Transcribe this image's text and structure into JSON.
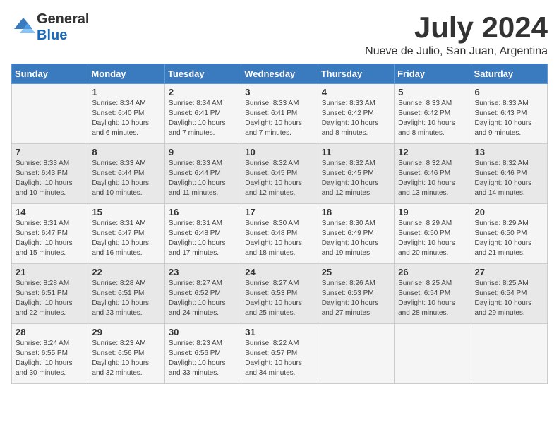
{
  "logo": {
    "general": "General",
    "blue": "Blue"
  },
  "title": "July 2024",
  "location": "Nueve de Julio, San Juan, Argentina",
  "days_of_week": [
    "Sunday",
    "Monday",
    "Tuesday",
    "Wednesday",
    "Thursday",
    "Friday",
    "Saturday"
  ],
  "weeks": [
    [
      {
        "day": "",
        "sunrise": "",
        "sunset": "",
        "daylight": ""
      },
      {
        "day": "1",
        "sunrise": "Sunrise: 8:34 AM",
        "sunset": "Sunset: 6:40 PM",
        "daylight": "Daylight: 10 hours and 6 minutes."
      },
      {
        "day": "2",
        "sunrise": "Sunrise: 8:34 AM",
        "sunset": "Sunset: 6:41 PM",
        "daylight": "Daylight: 10 hours and 7 minutes."
      },
      {
        "day": "3",
        "sunrise": "Sunrise: 8:33 AM",
        "sunset": "Sunset: 6:41 PM",
        "daylight": "Daylight: 10 hours and 7 minutes."
      },
      {
        "day": "4",
        "sunrise": "Sunrise: 8:33 AM",
        "sunset": "Sunset: 6:42 PM",
        "daylight": "Daylight: 10 hours and 8 minutes."
      },
      {
        "day": "5",
        "sunrise": "Sunrise: 8:33 AM",
        "sunset": "Sunset: 6:42 PM",
        "daylight": "Daylight: 10 hours and 8 minutes."
      },
      {
        "day": "6",
        "sunrise": "Sunrise: 8:33 AM",
        "sunset": "Sunset: 6:43 PM",
        "daylight": "Daylight: 10 hours and 9 minutes."
      }
    ],
    [
      {
        "day": "7",
        "sunrise": "Sunrise: 8:33 AM",
        "sunset": "Sunset: 6:43 PM",
        "daylight": "Daylight: 10 hours and 10 minutes."
      },
      {
        "day": "8",
        "sunrise": "Sunrise: 8:33 AM",
        "sunset": "Sunset: 6:44 PM",
        "daylight": "Daylight: 10 hours and 10 minutes."
      },
      {
        "day": "9",
        "sunrise": "Sunrise: 8:33 AM",
        "sunset": "Sunset: 6:44 PM",
        "daylight": "Daylight: 10 hours and 11 minutes."
      },
      {
        "day": "10",
        "sunrise": "Sunrise: 8:32 AM",
        "sunset": "Sunset: 6:45 PM",
        "daylight": "Daylight: 10 hours and 12 minutes."
      },
      {
        "day": "11",
        "sunrise": "Sunrise: 8:32 AM",
        "sunset": "Sunset: 6:45 PM",
        "daylight": "Daylight: 10 hours and 12 minutes."
      },
      {
        "day": "12",
        "sunrise": "Sunrise: 8:32 AM",
        "sunset": "Sunset: 6:46 PM",
        "daylight": "Daylight: 10 hours and 13 minutes."
      },
      {
        "day": "13",
        "sunrise": "Sunrise: 8:32 AM",
        "sunset": "Sunset: 6:46 PM",
        "daylight": "Daylight: 10 hours and 14 minutes."
      }
    ],
    [
      {
        "day": "14",
        "sunrise": "Sunrise: 8:31 AM",
        "sunset": "Sunset: 6:47 PM",
        "daylight": "Daylight: 10 hours and 15 minutes."
      },
      {
        "day": "15",
        "sunrise": "Sunrise: 8:31 AM",
        "sunset": "Sunset: 6:47 PM",
        "daylight": "Daylight: 10 hours and 16 minutes."
      },
      {
        "day": "16",
        "sunrise": "Sunrise: 8:31 AM",
        "sunset": "Sunset: 6:48 PM",
        "daylight": "Daylight: 10 hours and 17 minutes."
      },
      {
        "day": "17",
        "sunrise": "Sunrise: 8:30 AM",
        "sunset": "Sunset: 6:48 PM",
        "daylight": "Daylight: 10 hours and 18 minutes."
      },
      {
        "day": "18",
        "sunrise": "Sunrise: 8:30 AM",
        "sunset": "Sunset: 6:49 PM",
        "daylight": "Daylight: 10 hours and 19 minutes."
      },
      {
        "day": "19",
        "sunrise": "Sunrise: 8:29 AM",
        "sunset": "Sunset: 6:50 PM",
        "daylight": "Daylight: 10 hours and 20 minutes."
      },
      {
        "day": "20",
        "sunrise": "Sunrise: 8:29 AM",
        "sunset": "Sunset: 6:50 PM",
        "daylight": "Daylight: 10 hours and 21 minutes."
      }
    ],
    [
      {
        "day": "21",
        "sunrise": "Sunrise: 8:28 AM",
        "sunset": "Sunset: 6:51 PM",
        "daylight": "Daylight: 10 hours and 22 minutes."
      },
      {
        "day": "22",
        "sunrise": "Sunrise: 8:28 AM",
        "sunset": "Sunset: 6:51 PM",
        "daylight": "Daylight: 10 hours and 23 minutes."
      },
      {
        "day": "23",
        "sunrise": "Sunrise: 8:27 AM",
        "sunset": "Sunset: 6:52 PM",
        "daylight": "Daylight: 10 hours and 24 minutes."
      },
      {
        "day": "24",
        "sunrise": "Sunrise: 8:27 AM",
        "sunset": "Sunset: 6:53 PM",
        "daylight": "Daylight: 10 hours and 25 minutes."
      },
      {
        "day": "25",
        "sunrise": "Sunrise: 8:26 AM",
        "sunset": "Sunset: 6:53 PM",
        "daylight": "Daylight: 10 hours and 27 minutes."
      },
      {
        "day": "26",
        "sunrise": "Sunrise: 8:25 AM",
        "sunset": "Sunset: 6:54 PM",
        "daylight": "Daylight: 10 hours and 28 minutes."
      },
      {
        "day": "27",
        "sunrise": "Sunrise: 8:25 AM",
        "sunset": "Sunset: 6:54 PM",
        "daylight": "Daylight: 10 hours and 29 minutes."
      }
    ],
    [
      {
        "day": "28",
        "sunrise": "Sunrise: 8:24 AM",
        "sunset": "Sunset: 6:55 PM",
        "daylight": "Daylight: 10 hours and 30 minutes."
      },
      {
        "day": "29",
        "sunrise": "Sunrise: 8:23 AM",
        "sunset": "Sunset: 6:56 PM",
        "daylight": "Daylight: 10 hours and 32 minutes."
      },
      {
        "day": "30",
        "sunrise": "Sunrise: 8:23 AM",
        "sunset": "Sunset: 6:56 PM",
        "daylight": "Daylight: 10 hours and 33 minutes."
      },
      {
        "day": "31",
        "sunrise": "Sunrise: 8:22 AM",
        "sunset": "Sunset: 6:57 PM",
        "daylight": "Daylight: 10 hours and 34 minutes."
      },
      {
        "day": "",
        "sunrise": "",
        "sunset": "",
        "daylight": ""
      },
      {
        "day": "",
        "sunrise": "",
        "sunset": "",
        "daylight": ""
      },
      {
        "day": "",
        "sunrise": "",
        "sunset": "",
        "daylight": ""
      }
    ]
  ]
}
